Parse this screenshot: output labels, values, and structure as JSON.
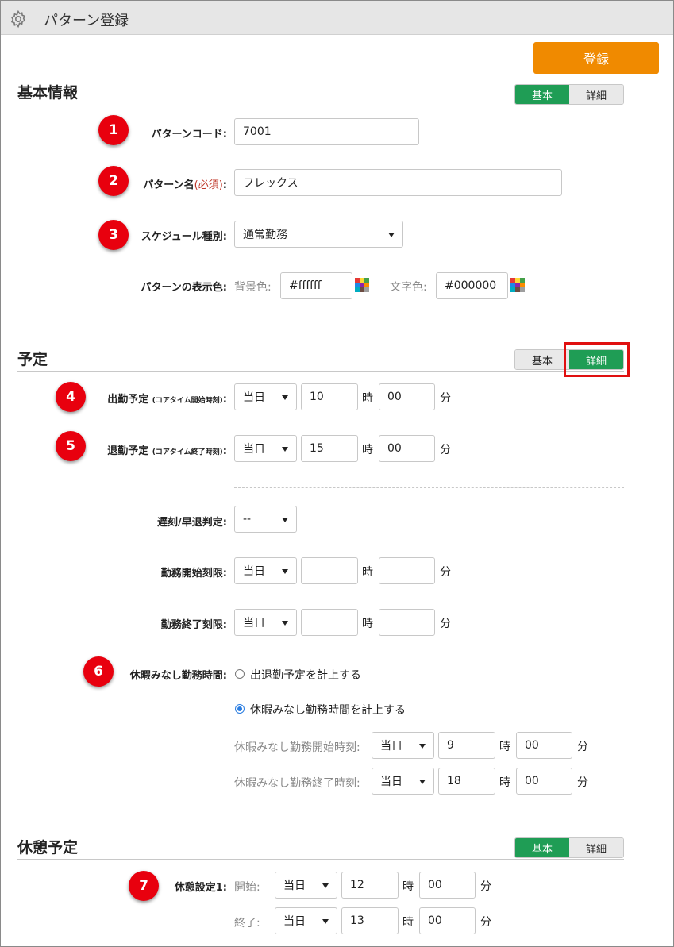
{
  "header": {
    "title": "パターン登録",
    "icon": "gear-icon"
  },
  "register_button": "登録",
  "toggle": {
    "basic": "基本",
    "detail": "詳細"
  },
  "basic_info": {
    "title": "基本情報",
    "pattern_code": {
      "label": "パターンコード:",
      "value": "7001"
    },
    "pattern_name": {
      "label": "パターン名",
      "required": "(必須)",
      "colon": ":",
      "value": "フレックス"
    },
    "schedule_type": {
      "label": "スケジュール種別:",
      "value": "通常勤務"
    },
    "display_color": {
      "label": "パターンの表示色:",
      "bg_label": "背景色:",
      "bg_value": "#ffffff",
      "text_label": "文字色:",
      "text_value": "#000000"
    }
  },
  "schedule": {
    "title": "予定",
    "clock_in": {
      "label": "出勤予定",
      "sub": "(コアタイム開始時刻)",
      "colon": ":",
      "day": "当日",
      "hour": "10",
      "minute": "00"
    },
    "clock_out": {
      "label": "退勤予定",
      "sub": "(コアタイム終了時刻)",
      "colon": ":",
      "day": "当日",
      "hour": "15",
      "minute": "00"
    },
    "late_judgment": {
      "label": "遅刻/早退判定:",
      "value": "--"
    },
    "work_start_limit": {
      "label": "勤務開始刻限:",
      "day": "当日",
      "hour": "",
      "minute": ""
    },
    "work_end_limit": {
      "label": "勤務終了刻限:",
      "day": "当日",
      "hour": "",
      "minute": ""
    },
    "leave_deemed": {
      "label": "休暇みなし勤務時間:",
      "option1": "出退勤予定を計上する",
      "option2": "休暇みなし勤務時間を計上する",
      "start": {
        "label": "休暇みなし勤務開始時刻:",
        "day": "当日",
        "hour": "9",
        "minute": "00"
      },
      "end": {
        "label": "休暇みなし勤務終了時刻:",
        "day": "当日",
        "hour": "18",
        "minute": "00"
      }
    }
  },
  "break_schedule": {
    "title": "休憩予定",
    "label": "休憩設定1:",
    "start": {
      "label": "開始:",
      "day": "当日",
      "hour": "12",
      "minute": "00"
    },
    "end": {
      "label": "終了:",
      "day": "当日",
      "hour": "13",
      "minute": "00"
    }
  },
  "units": {
    "hour": "時",
    "minute": "分"
  },
  "badges": [
    "1",
    "2",
    "3",
    "4",
    "5",
    "6",
    "7"
  ],
  "colors": {
    "accent_green": "#1f9d55",
    "register_orange": "#f08a00",
    "badge_red": "#e8000e",
    "highlight_red": "#e01010"
  }
}
